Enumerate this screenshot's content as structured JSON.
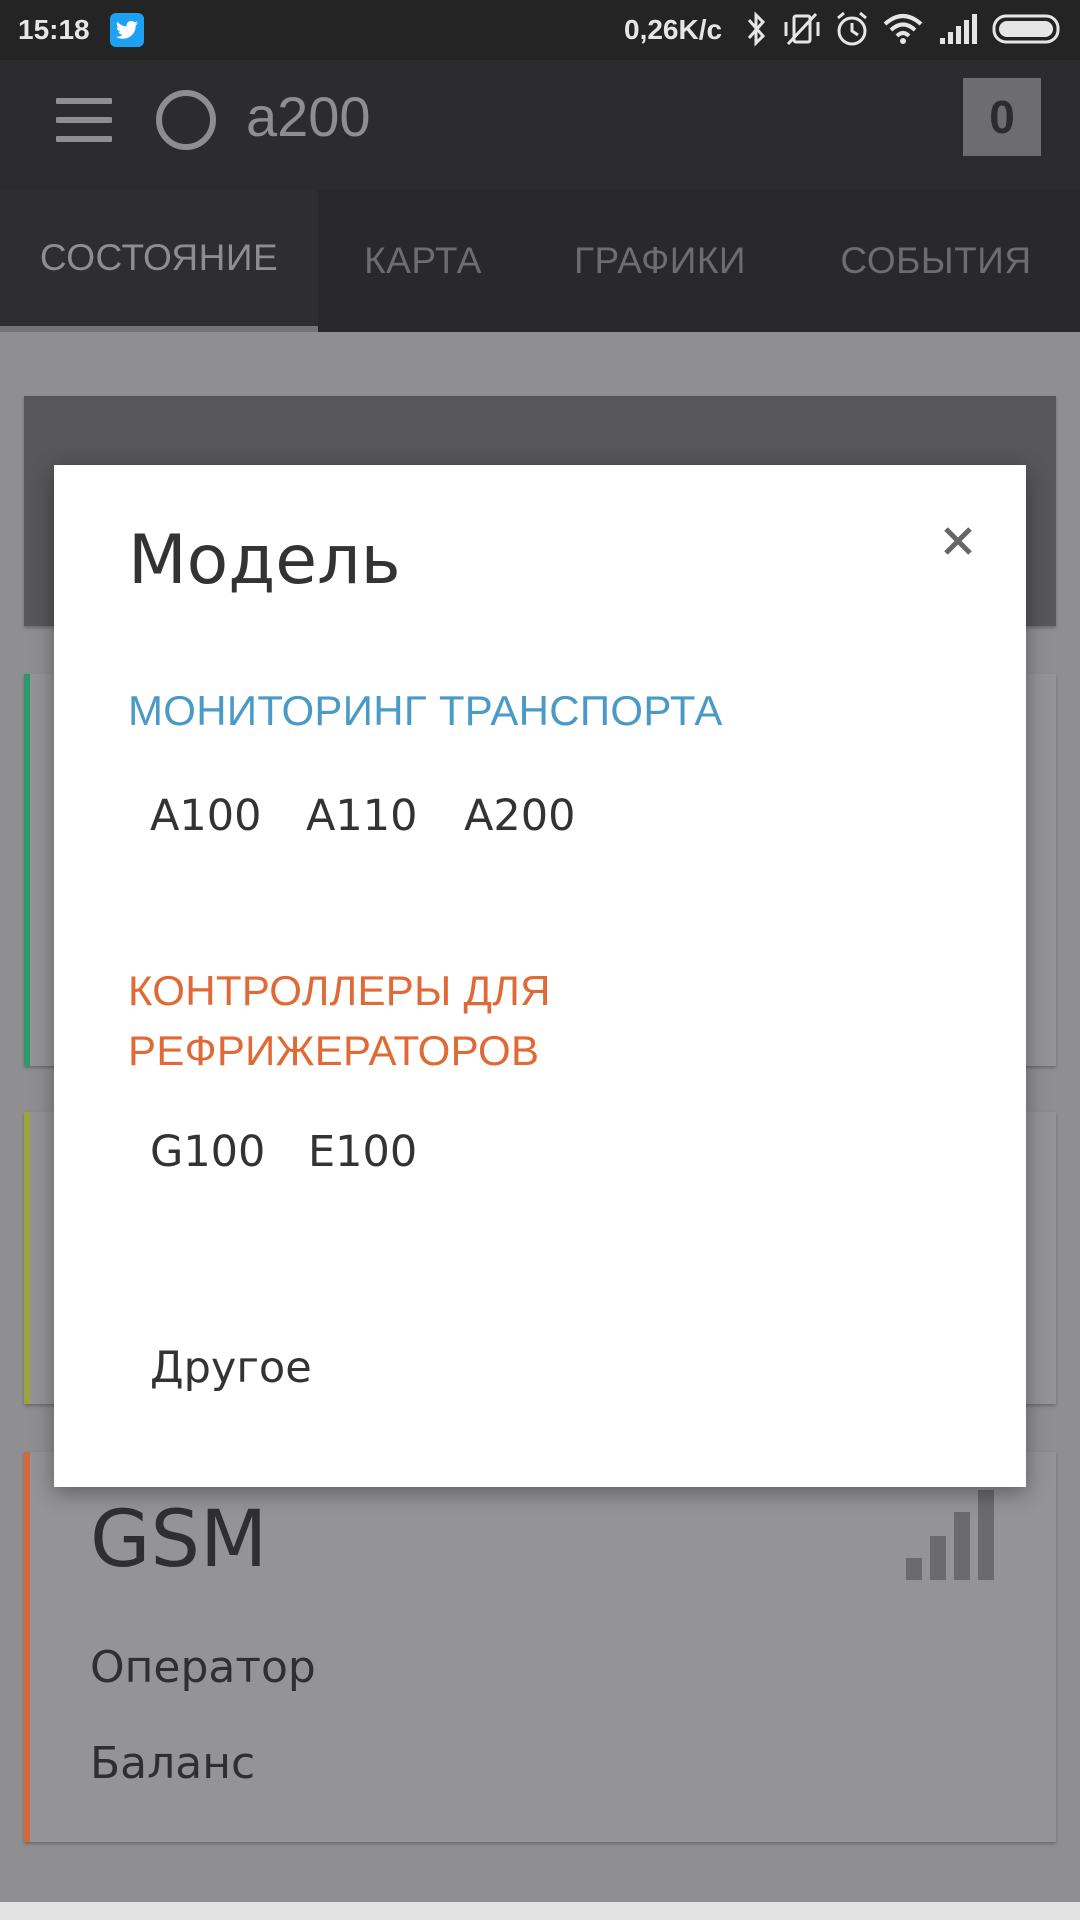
{
  "status_bar": {
    "time": "15:18",
    "net_rate": "0,26K/с",
    "icons": [
      "twitter-icon",
      "bluetooth-icon",
      "vibrate-off-icon",
      "alarm-icon",
      "wifi-icon",
      "cell-signal-icon",
      "battery-icon"
    ]
  },
  "app_bar": {
    "title": "a200",
    "counter": "0"
  },
  "tabs": [
    {
      "label": "СОСТОЯНИЕ",
      "active": true
    },
    {
      "label": "КАРТА",
      "active": false
    },
    {
      "label": "ГРАФИКИ",
      "active": false
    },
    {
      "label": "СОБЫТИЯ",
      "active": false
    }
  ],
  "background": {
    "gsm_card": {
      "title": "GSM",
      "operator_label": "Оператор",
      "balance_label": "Баланс"
    }
  },
  "dialog": {
    "title": "Модель",
    "sections": [
      {
        "title": "МОНИТОРИНГ ТРАНСПОРТА",
        "color": "#4a9ac8",
        "models": [
          "A100",
          "A110",
          "A200"
        ]
      },
      {
        "title": "КОНТРОЛЛЕРЫ ДЛЯ РЕФРИЖЕРАТОРОВ",
        "color": "#e06a35",
        "models": [
          "G100",
          "E100"
        ]
      }
    ],
    "other_label": "Другое"
  },
  "colors": {
    "dialog_background": "#ffffff",
    "scrim": "#8f8e91",
    "accent_green": "#2a9a6e",
    "accent_olive": "#9aa43c",
    "accent_orange": "#d4683a"
  }
}
